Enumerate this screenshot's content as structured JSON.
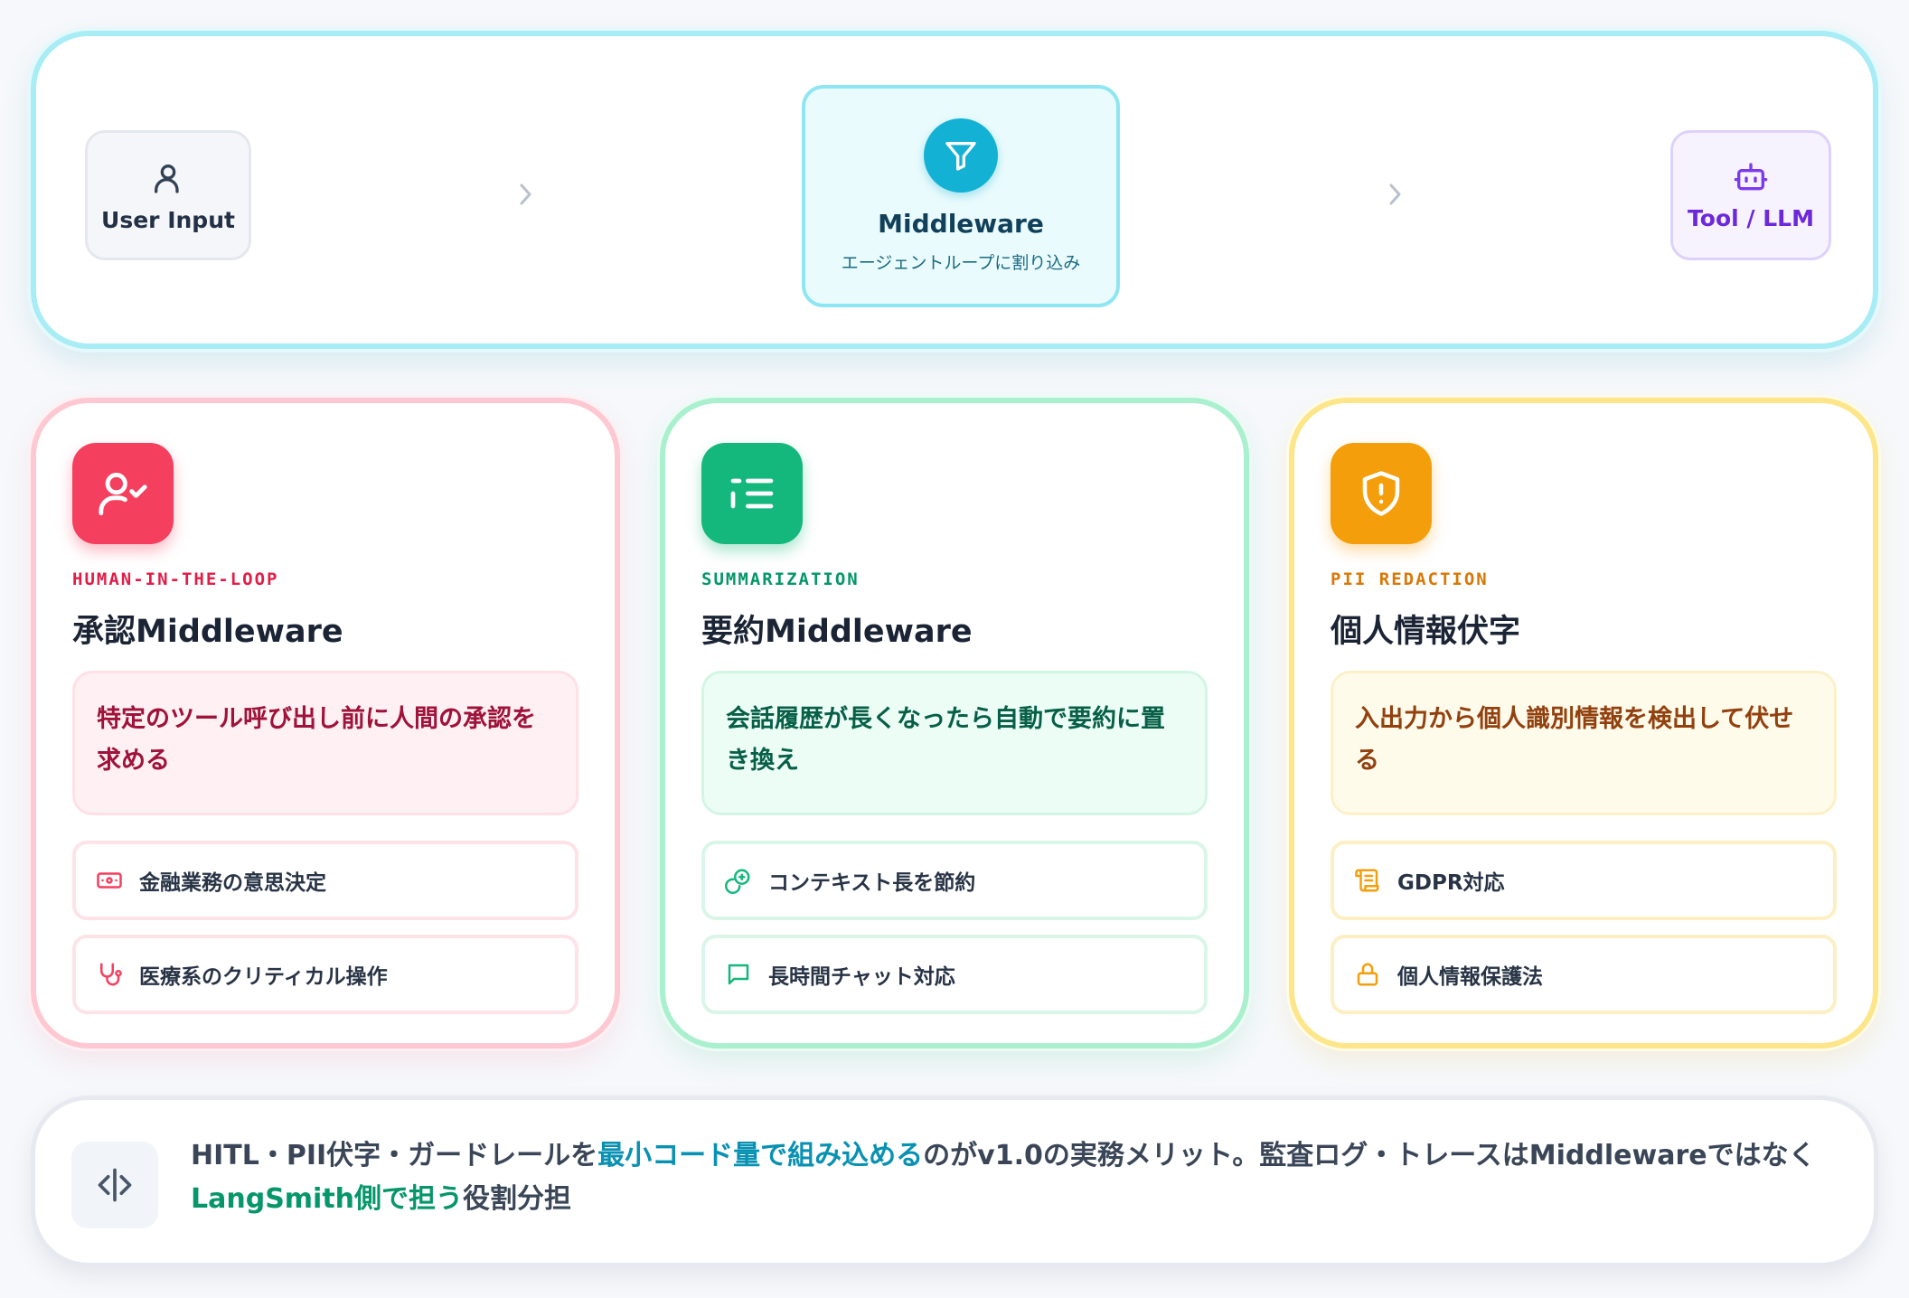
{
  "flow": {
    "user_input": "User Input",
    "middleware_title": "Middleware",
    "middleware_sub": "エージェントループに割り込み",
    "tool_llm": "Tool / LLM",
    "icons": [
      "user-icon",
      "chevron-right-icon",
      "filter-icon",
      "chevron-right-icon",
      "bot-icon"
    ]
  },
  "cards": [
    {
      "tag": "HUMAN-IN-THE-LOOP",
      "title": "承認Middleware",
      "desc": "特定のツール呼び出し前に人間の承認を求める",
      "features": [
        "金融業務の意思決定",
        "医療系のクリティカル操作"
      ],
      "color": "#f43f5e",
      "icons": [
        "user-check-icon",
        "banknote-icon",
        "stethoscope-icon"
      ]
    },
    {
      "tag": "SUMMARIZATION",
      "title": "要約Middleware",
      "desc": "会話履歴が長くなったら自動で要約に置き換え",
      "features": [
        "コンテキスト長を節約",
        "長時間チャット対応"
      ],
      "color": "#14b87c",
      "icons": [
        "list-icon",
        "coins-icon",
        "message-square-icon"
      ]
    },
    {
      "tag": "PII REDACTION",
      "title": "個人情報伏字",
      "desc": "入出力から個人識別情報を検出して伏せる",
      "features": [
        "GDPR対応",
        "個人情報保護法"
      ],
      "color": "#f59e0b",
      "icons": [
        "shield-alert-icon",
        "scroll-icon",
        "lock-icon"
      ]
    }
  ],
  "note": {
    "part1": "HITL・PII伏字・ガードレールを",
    "highlight1": "最小コード量で組み込める",
    "part2": "のがv1.0の実務メリット。監査ログ・トレースはMiddlewareではなく",
    "highlight2": "LangSmith側で担う",
    "part3": "役割分担",
    "icon": "code-split-icon"
  }
}
